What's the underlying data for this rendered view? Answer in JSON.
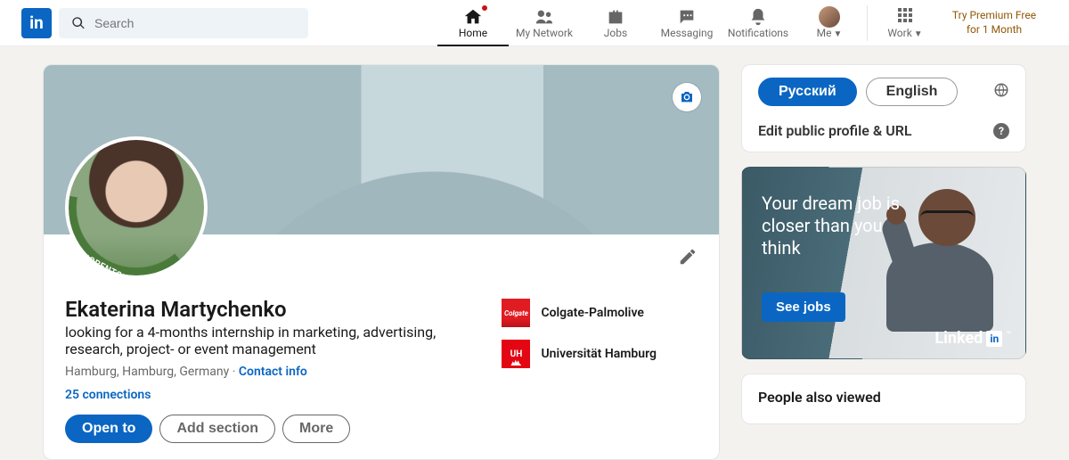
{
  "search": {
    "placeholder": "Search"
  },
  "nav": {
    "home": "Home",
    "network": "My Network",
    "jobs": "Jobs",
    "messaging": "Messaging",
    "notifications": "Notifications",
    "me": "Me",
    "work": "Work",
    "premium": "Try Premium Free for 1 Month"
  },
  "profile": {
    "open_to_work_badge": "#OPENTOWORK",
    "name": "Ekaterina Martychenko",
    "headline": "looking for a 4-months internship in marketing, advertising, research, project- or event management",
    "location": "Hamburg, Hamburg, Germany",
    "location_separator": " · ",
    "contact_info": "Contact info",
    "connections": "25 connections",
    "actions": {
      "open_to": "Open to",
      "add_section": "Add section",
      "more": "More"
    },
    "experience": [
      {
        "label": "Colgate-Palmolive"
      },
      {
        "label": "Universität Hamburg"
      }
    ]
  },
  "side": {
    "lang_ru": "Русский",
    "lang_en": "English",
    "edit_public": "Edit public profile & URL",
    "ad": {
      "line1": "Your dream job is closer than you think",
      "cta": "See jobs",
      "brand": "Linked",
      "brand_suffix": "in"
    },
    "people_also_viewed": "People also viewed"
  }
}
